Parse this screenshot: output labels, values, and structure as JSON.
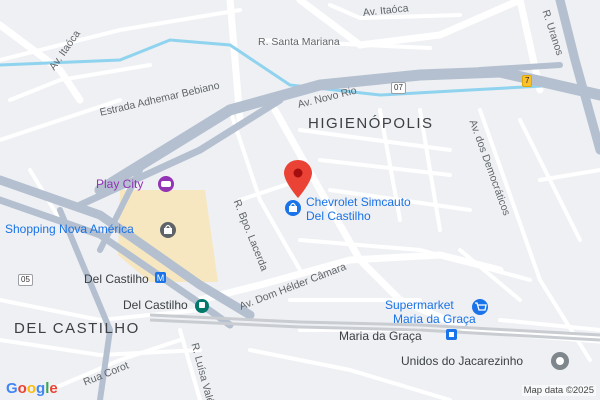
{
  "streets": {
    "av_itaoca_top": "Av. Itaóca",
    "av_itaoca_left": "Av. Itaóca",
    "r_santa_mariana": "R. Santa Mariana",
    "r_uranos": "R. Uranos",
    "estrada_adhemar": "Estrada Adhemar Bebiano",
    "av_novo_rio": "Av. Novo Rio",
    "av_democraticos": "Av. dos Democráticos",
    "r_bpo_lacerda": "R. Bpo. Lacerda",
    "av_dom_helder": "Av. Dom Hélder Câmara",
    "r_luisa_vale": "R. Luísa Valé",
    "rua_corot": "Rua Corot"
  },
  "districts": {
    "higienopolis": "HIGIENÓPOLIS",
    "del_castilho": "DEL CASTILHO"
  },
  "pois": {
    "play_city": "Play City",
    "shopping": "Shopping Nova América",
    "chevrolet_line1": "Chevrolet Simcauto",
    "chevrolet_line2": "Del Castilho",
    "station_del_castilho_top": "Del Castilho",
    "station_del_castilho": "Del Castilho",
    "supermarket_line1": "Supermarket",
    "supermarket_line2": "Maria da Graça",
    "maria_da_graca": "Maria da Graça",
    "unidos": "Unidos do Jacarezinho"
  },
  "shields": {
    "s07": "07",
    "s7": "7",
    "s05": "05"
  },
  "footer": {
    "logo": "Google",
    "attribution": "Map data ©2025"
  },
  "colors": {
    "highway": "#b4c0d0",
    "canal": "#8fd3ef",
    "shopping_area": "#f6e7c1",
    "pin": "#ea4335"
  },
  "icons": {
    "pin": "red-location-pin-icon",
    "shopping": "shopping-bag-icon",
    "game": "gamepad-icon",
    "metro": "metro-station-icon",
    "train": "train-station-icon",
    "cart": "shopping-cart-icon",
    "landmark": "landmark-icon"
  }
}
